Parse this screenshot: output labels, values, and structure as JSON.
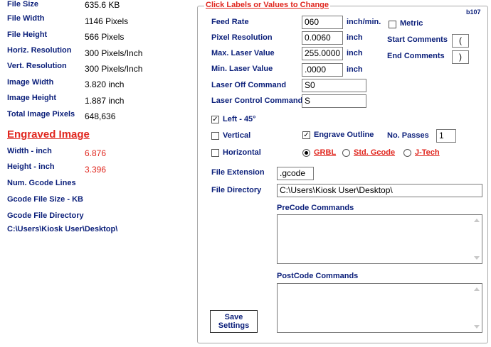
{
  "info": {
    "file_size_label": "File Size",
    "file_size_value": "635.6  KB",
    "file_width_label": "File Width",
    "file_width_value": "1146  Pixels",
    "file_height_label": "File Height",
    "file_height_value": "566  Pixels",
    "hres_label": "Horiz. Resolution",
    "hres_value": "300  Pixels/Inch",
    "vres_label": "Vert. Resolution",
    "vres_value": "300  Pixels/Inch",
    "img_width_label": "Image Width",
    "img_width_value": "3.820 inch",
    "img_height_label": "Image Height",
    "img_height_value": "1.887 inch",
    "total_pixels_label": "Total Image Pixels",
    "total_pixels_value": "648,636"
  },
  "engraved": {
    "heading": "Engraved Image",
    "width_label": "Width - inch",
    "width_value": "6.876",
    "height_label": "Height - inch",
    "height_value": "3.396",
    "gcode_lines_label": "Num. Gcode Lines",
    "gcode_size_label": "Gcode File Size - KB",
    "gcode_dir_label": "Gcode File Directory",
    "gcode_dir_value": "C:\\Users\\Kiosk User\\Desktop\\"
  },
  "settings": {
    "legend": "Click Labels or Values to Change",
    "version": "b107",
    "feed_rate_label": "Feed Rate",
    "feed_rate_value": "060",
    "feed_rate_unit": "inch/min.",
    "pixel_res_label": "Pixel Resolution",
    "pixel_res_value": "0.0060",
    "pixel_res_unit": "inch",
    "max_laser_label": "Max. Laser Value",
    "max_laser_value": "255.0000",
    "max_laser_unit": "inch",
    "min_laser_label": "Min. Laser Value",
    "min_laser_value": ".0000",
    "min_laser_unit": "inch",
    "laser_off_label": "Laser Off Command",
    "laser_off_value": "S0",
    "laser_control_label": "Laser Control Command",
    "laser_control_value": "S",
    "metric_label": "Metric",
    "metric_checked": false,
    "start_comments_label": "Start Comments",
    "start_comments_value": "(",
    "end_comments_label": "End Comments",
    "end_comments_value": ")",
    "left45_label": "Left - 45°",
    "left45_checked": true,
    "vertical_label": "Vertical",
    "vertical_checked": false,
    "horizontal_label": "Horizontal",
    "horizontal_checked": false,
    "engrave_outline_label": "Engrave Outline",
    "engrave_outline_checked": true,
    "passes_label": "No. Passes",
    "passes_value": "1",
    "radio_grbl": "GRBL",
    "radio_std": "Std. Gcode",
    "radio_jtech": "J-Tech",
    "radio_selected": "GRBL",
    "file_ext_label": "File Extension",
    "file_ext_value": ".gcode",
    "file_dir_label": "File Directory",
    "file_dir_value": "C:\\Users\\Kiosk User\\Desktop\\",
    "precode_label": "PreCode Commands",
    "precode_value": "",
    "postcode_label": "PostCode Commands",
    "postcode_value": "",
    "save_label_1": "Save",
    "save_label_2": "Settings"
  }
}
